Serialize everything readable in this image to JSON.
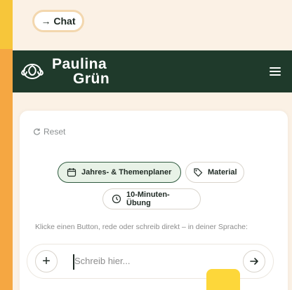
{
  "chat_button": {
    "label": "→ Chat"
  },
  "brand": {
    "line1": "Paulina",
    "line2": "Grün"
  },
  "card": {
    "reset_label": "Reset",
    "buttons": [
      {
        "label": "Jahres- & Themenplaner",
        "icon": "calendar-icon",
        "selected": true
      },
      {
        "label": "Material",
        "icon": "tag-icon",
        "selected": false
      },
      {
        "label": "10-Minuten-Übung",
        "icon": "clock-icon",
        "selected": false
      }
    ],
    "hint": "Klicke einen Button, rede oder schreib direkt – in deiner Sprache:",
    "input": {
      "placeholder": "Schreib hier..."
    }
  },
  "colors": {
    "header_bg": "#1f3a2b",
    "page_bg": "#fbf1e5",
    "accent_yellow": "#fdd73a",
    "primary_chip_bg": "#e8f2e7",
    "primary_chip_border": "#2f5a3f"
  }
}
